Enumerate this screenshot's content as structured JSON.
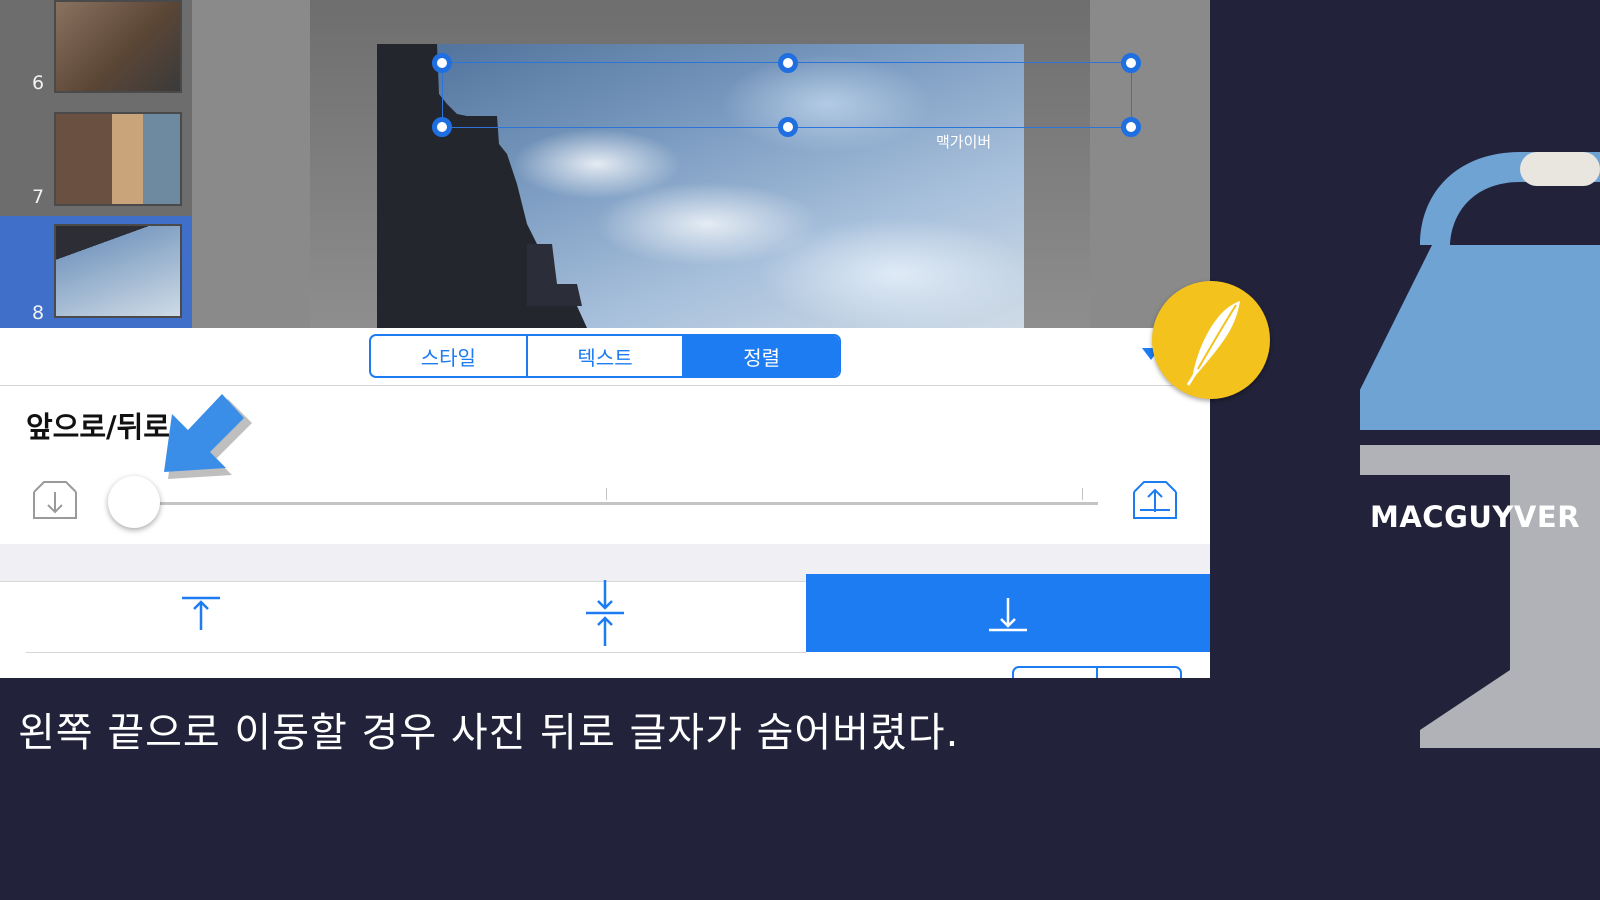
{
  "slides": [
    {
      "number": "6"
    },
    {
      "number": "7"
    },
    {
      "number": "8",
      "selected": true
    }
  ],
  "canvas": {
    "text_box_label": "맥가이버"
  },
  "inspector": {
    "tabs": [
      {
        "label": "스타일",
        "active": false
      },
      {
        "label": "텍스트",
        "active": false
      },
      {
        "label": "정렬",
        "active": true
      }
    ],
    "section_title": "앞으로/뒤로",
    "layer_slider": {
      "value_fraction": 0.0
    },
    "vertical_align": {
      "options": [
        "top-align-icon",
        "middle-align-icon",
        "bottom-align-icon"
      ],
      "selected": "bottom"
    }
  },
  "brand": {
    "name": "MACGUYVER"
  },
  "subtitle": "왼쪽 끝으로 이동할 경우 사진 뒤로 글자가 숨어버렸다.",
  "colors": {
    "accent": "#1d7cf2",
    "logo_yellow": "#f3c21c",
    "background": "#22223a",
    "brand_blue": "#6ea3d4"
  }
}
